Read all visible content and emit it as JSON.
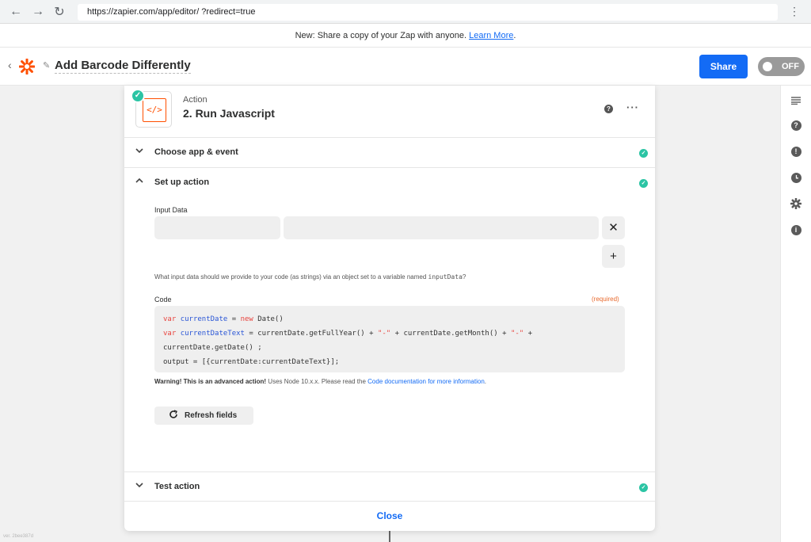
{
  "browser": {
    "back_glyph": "←",
    "forward_glyph": "→",
    "reload_glyph": "↻",
    "url": "https://zapier.com/app/editor/                    ?redirect=true",
    "menu_glyph": "⋮"
  },
  "banner": {
    "text": "New: Share a copy of your Zap with anyone.",
    "link": "Learn More",
    "suffix": "."
  },
  "header": {
    "back_glyph": "‹",
    "pencil_glyph": "✎",
    "zap_title": "Add Barcode Differently",
    "share_label": "Share",
    "toggle_label": "OFF"
  },
  "step": {
    "kind": "Action",
    "title": "2. Run Javascript",
    "icon_glyph": "</>",
    "help_glyph": "?",
    "more_glyph": "···"
  },
  "sections": {
    "choose_app": "Choose app & event",
    "setup_action": "Set up action",
    "test_action": "Test action"
  },
  "form": {
    "input_data_label": "Input Data",
    "remove_glyph": "✕",
    "add_glyph": "+",
    "help_prefix": "What input data should we provide to your code (as strings) via an object set to a variable named ",
    "help_code": "inputData",
    "help_suffix": "?",
    "code_label": "Code",
    "required_label": "(required)",
    "code_lines": [
      "var currentDate = new Date()",
      "var currentDateText = currentDate.getFullYear() + \"-\" + currentDate.getMonth() + \"-\" +",
      "currentDate.getDate() ;",
      "output = [{currentDate:currentDateText}];"
    ],
    "warning_bold": "Warning! This is an advanced action!",
    "warning_text": " Uses Node 10.x.x. Please read the ",
    "warning_link": "Code documentation for more information",
    "warning_end": ".",
    "refresh_label": "Refresh fields"
  },
  "close_label": "Close",
  "version": "ver. 2bee387d",
  "colors": {
    "accent": "#136bf5",
    "success": "#2bc4a4",
    "brand": "#ff4f00",
    "required": "#e8692d"
  }
}
